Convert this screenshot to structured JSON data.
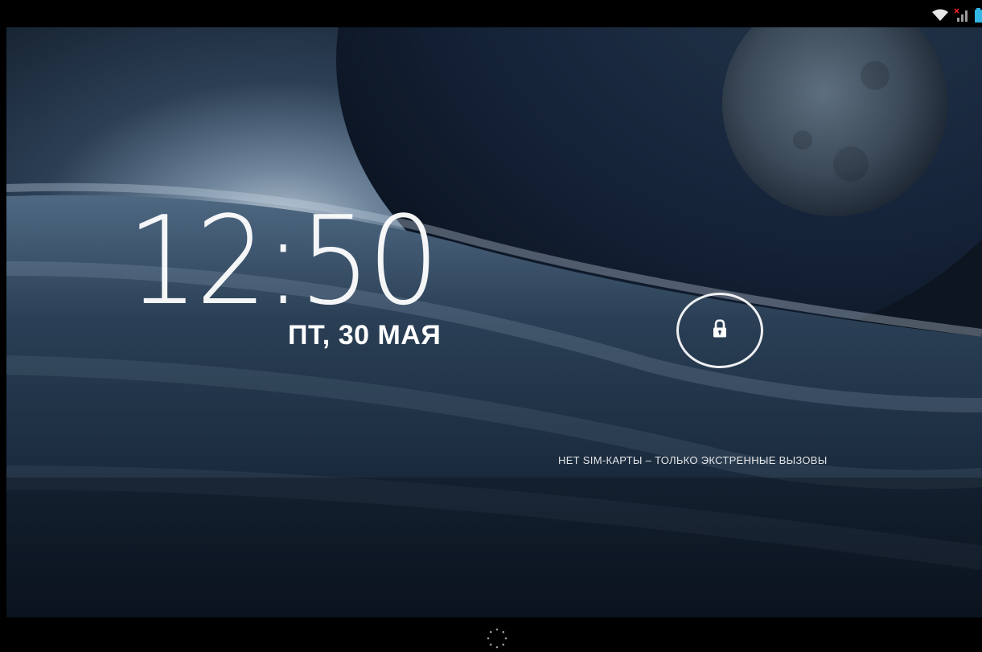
{
  "status_bar": {
    "icons": [
      "wifi-icon",
      "no-sim-signal-icon",
      "battery-icon"
    ],
    "accent_color": "#33b5e5"
  },
  "lockscreen": {
    "time": "12:50",
    "date": "ПТ, 30 МАЯ",
    "carrier_text": "НЕТ SIM-КАРТЫ – ТОЛЬКО ЭКСТРЕННЫЕ ВЫЗОВЫ",
    "unlock_icon": "lock-icon"
  },
  "nav_bar": {
    "icons": [
      "loading-spinner-icon"
    ]
  }
}
